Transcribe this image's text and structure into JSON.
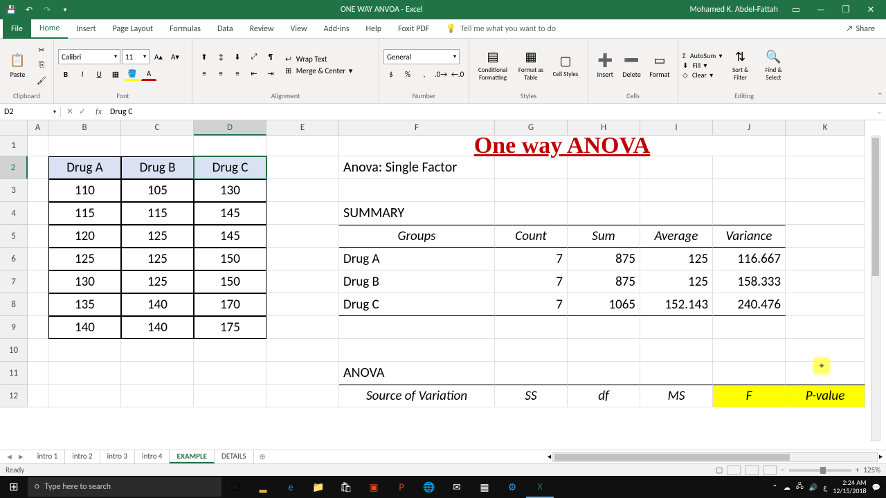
{
  "titlebar": {
    "title": "ONE WAY ANVOA - Excel",
    "user": "Mohamed K. Abdel-Fattah"
  },
  "ribbon_tabs": [
    "File",
    "Home",
    "Insert",
    "Page Layout",
    "Formulas",
    "Data",
    "Review",
    "View",
    "Add-ins",
    "Help",
    "Foxit PDF"
  ],
  "active_tab": "Home",
  "tell_me": "Tell me what you want to do",
  "share": "Share",
  "ribbon": {
    "clipboard": {
      "paste": "Paste",
      "label": "Clipboard"
    },
    "font": {
      "name": "Calibri",
      "size": "11",
      "label": "Font"
    },
    "alignment": {
      "wrap": "Wrap Text",
      "merge": "Merge & Center",
      "label": "Alignment"
    },
    "number": {
      "format": "General",
      "label": "Number"
    },
    "styles": {
      "cond": "Conditional Formatting",
      "table": "Format as Table",
      "cell": "Cell Styles",
      "label": "Styles"
    },
    "cells": {
      "insert": "Insert",
      "delete": "Delete",
      "format": "Format",
      "label": "Cells"
    },
    "editing": {
      "autosum": "AutoSum",
      "fill": "Fill",
      "clear": "Clear",
      "sort": "Sort & Filter",
      "find": "Find & Select",
      "label": "Editing"
    }
  },
  "name_box": "D2",
  "formula": "Drug C",
  "columns": [
    "A",
    "B",
    "C",
    "D",
    "E",
    "F",
    "G",
    "H",
    "I",
    "J",
    "K"
  ],
  "rows": [
    "1",
    "2",
    "3",
    "4",
    "5",
    "6",
    "7",
    "8",
    "9",
    "10",
    "11",
    "12"
  ],
  "selected_col": "D",
  "selected_row": "2",
  "data_table": {
    "headers": [
      "Drug A",
      "Drug B",
      "Drug C"
    ],
    "rows": [
      [
        "110",
        "105",
        "130"
      ],
      [
        "115",
        "115",
        "145"
      ],
      [
        "120",
        "125",
        "145"
      ],
      [
        "125",
        "125",
        "150"
      ],
      [
        "130",
        "125",
        "150"
      ],
      [
        "135",
        "140",
        "170"
      ],
      [
        "140",
        "140",
        "175"
      ]
    ]
  },
  "anova": {
    "title": "One way ANOVA",
    "subtitle": "Anova: Single Factor",
    "summary_label": "SUMMARY",
    "summary_headers": [
      "Groups",
      "Count",
      "Sum",
      "Average",
      "Variance"
    ],
    "summary_rows": [
      [
        "Drug A",
        "7",
        "875",
        "125",
        "116.667"
      ],
      [
        "Drug B",
        "7",
        "875",
        "125",
        "158.333"
      ],
      [
        "Drug C",
        "7",
        "1065",
        "152.143",
        "240.476"
      ]
    ],
    "anova_label": "ANOVA",
    "anova_headers": [
      "Source of Variation",
      "SS",
      "df",
      "MS",
      "F",
      "P-value"
    ]
  },
  "sheet_tabs": [
    "intro 1",
    "intro 2",
    "intro 3",
    "intro 4",
    "EXAMPLE",
    "DETAILS"
  ],
  "active_sheet": "EXAMPLE",
  "status": "Ready",
  "zoom": "125%",
  "taskbar": {
    "search": "Type here to search",
    "time": "2:24 AM",
    "date": "12/15/2018"
  },
  "chart_data": {
    "type": "table",
    "title": "One way ANOVA - Summary",
    "columns": [
      "Groups",
      "Count",
      "Sum",
      "Average",
      "Variance"
    ],
    "rows": [
      {
        "Groups": "Drug A",
        "Count": 7,
        "Sum": 875,
        "Average": 125,
        "Variance": 116.667
      },
      {
        "Groups": "Drug B",
        "Count": 7,
        "Sum": 875,
        "Average": 125,
        "Variance": 158.333
      },
      {
        "Groups": "Drug C",
        "Count": 7,
        "Sum": 1065,
        "Average": 152.143,
        "Variance": 240.476
      }
    ]
  }
}
